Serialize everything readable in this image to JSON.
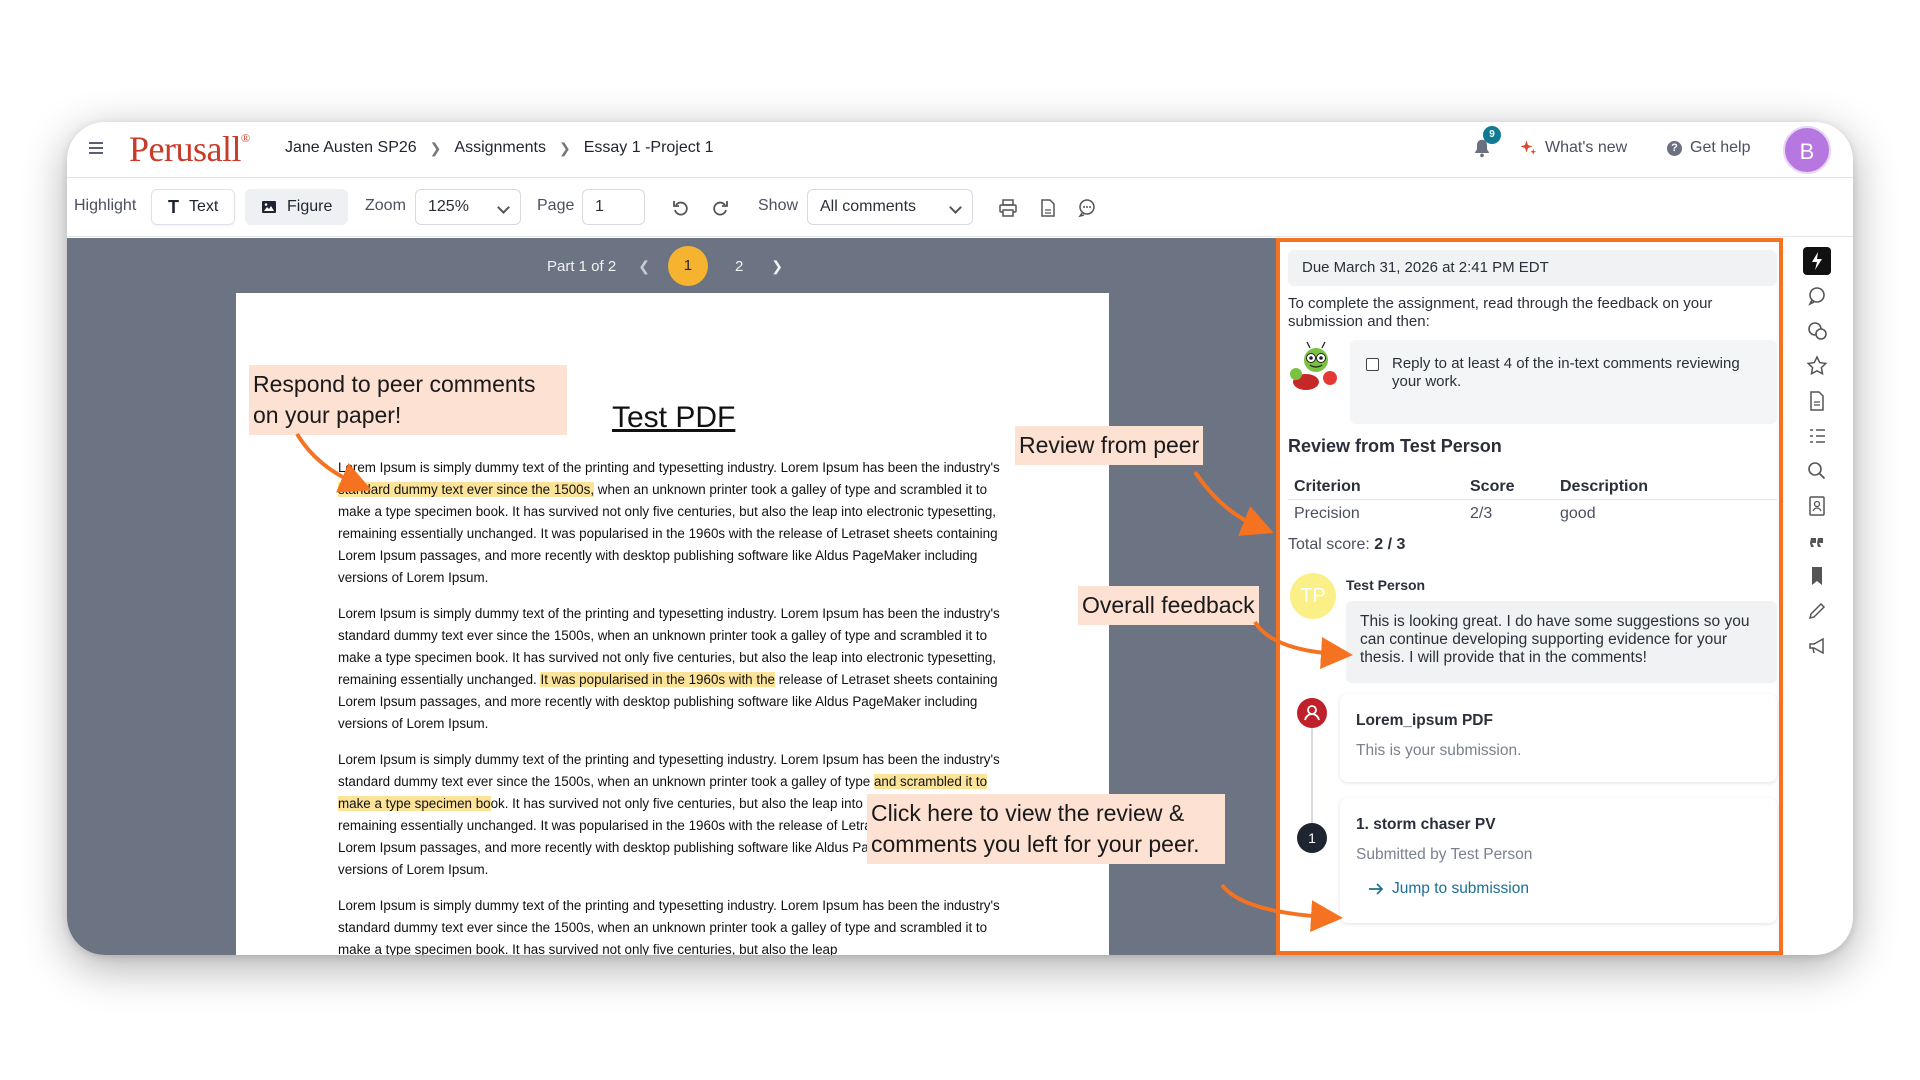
{
  "header": {
    "logo": "Perusall",
    "logo_mark": "®",
    "breadcrumbs": [
      "Jane Austen SP26",
      "Assignments",
      "Essay 1 -Project 1"
    ],
    "notification_count": "9",
    "whats_new": "What's new",
    "get_help": "Get help",
    "help_glyph": "?",
    "avatar_initial": "B"
  },
  "toolbar": {
    "highlight_label": "Highlight",
    "text_label": "Text",
    "figure_label": "Figure",
    "zoom_label": "Zoom",
    "zoom_value": "125%",
    "page_label": "Page",
    "page_value": "1",
    "show_label": "Show",
    "show_value": "All comments"
  },
  "pager": {
    "part_label": "Part 1 of 2",
    "pages": [
      "1",
      "2"
    ],
    "current_page": "1"
  },
  "document": {
    "title": "Test PDF",
    "p1": {
      "a": "Lorem Ipsum is simply dummy text of the printing and typesetting industry. Lorem Ipsum has been the industry's ",
      "hl": "standard dummy text ever since the 1500s,",
      "b": " when an unknown printer took a galley of type and scrambled it to make a type specimen book. It has survived not only five centuries, but also the leap into electronic typesetting, remaining essentially unchanged. It was popularised in the 1960s with the release of Letraset sheets containing Lorem Ipsum passages, and more recently with desktop publishing software like Aldus PageMaker including versions of Lorem Ipsum."
    },
    "p2": {
      "a": "Lorem Ipsum is simply dummy text of the printing and typesetting industry. Lorem Ipsum has been the industry's standard dummy text ever since the 1500s, when an unknown printer took a galley of type and scrambled it to make a type specimen book. It has survived not only five centuries, but also the leap into electronic typesetting, remaining essentially unchanged. ",
      "hl": "It was popularised in the 1960s with the",
      "b": " release of Letraset sheets containing Lorem Ipsum passages, and more recently with desktop publishing software like Aldus PageMaker including versions of Lorem Ipsum."
    },
    "p3": {
      "a": "Lorem Ipsum is simply dummy text of the printing and typesetting industry. Lorem Ipsum has been the industry's standard dummy text ever since the 1500s, when an unknown printer took a galley of type ",
      "hl": "and scrambled it to make a type specimen bo",
      "b": "ok. It has survived not only five centuries, but also the leap into electronic typesetting, remaining essentially unchanged. It was popularised in the 1960s with the release of Letraset sheets containing Lorem Ipsum passages, and more recently with desktop publishing software like Aldus PageMaker including versions of Lorem Ipsum."
    },
    "p4": "Lorem Ipsum is simply dummy text of the printing and typesetting industry. Lorem Ipsum has been the industry's standard dummy text ever since the 1500s, when an unknown printer took a galley of type and scrambled it to make a type specimen book. It has survived not only five centuries, but also the leap"
  },
  "annotations": {
    "respond": "Respond to peer comments on your paper!",
    "review_from_peer": "Review from peer",
    "overall_feedback": "Overall feedback",
    "click_here": "Click here to view the review & comments you left for your peer."
  },
  "panel": {
    "due": "Due March 31, 2026 at 2:41 PM EDT",
    "intro": "To complete the assignment, read through the feedback on your submission and then:",
    "task": "Reply to at least 4 of the in-text comments reviewing your work.",
    "review_heading": "Review from Test Person",
    "columns": [
      "Criterion",
      "Score",
      "Description"
    ],
    "rows": [
      [
        "Precision",
        "2/3",
        "good"
      ]
    ],
    "total_label": "Total score:",
    "total_value": "2 / 3",
    "reviewer_initials": "TP",
    "reviewer_name": "Test Person",
    "feedback": "This is looking great. I do have some suggestions so you can continue developing supporting evidence for your thesis. I will provide that in the comments!",
    "submission_title": "Lorem_ipsum PDF",
    "submission_sub": "This is your submission.",
    "peer_number": "1",
    "peer_title": "1. storm chaser PV",
    "peer_sub": "Submitted by Test Person",
    "jump_label": "Jump to submission"
  },
  "rail_icons": [
    "lightning-icon",
    "comment-icon",
    "conversation-icon",
    "star-icon",
    "document-icon",
    "outline-icon",
    "search-icon",
    "page-icon",
    "quote-icon",
    "bookmark-icon",
    "pencil-icon",
    "megaphone-icon"
  ],
  "colors": {
    "brand": "#c83a2a",
    "accent_orange": "#f57320",
    "current_page": "#f5b330",
    "highlight": "#fbe49a",
    "annotation_bg": "#fde1d3",
    "link": "#1b6f92",
    "avatar": "#b678e0"
  }
}
